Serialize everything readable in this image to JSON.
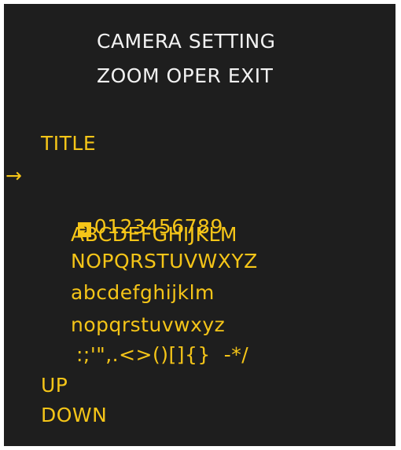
{
  "header": {
    "line1": "CAMERA SETTING",
    "line2": "ZOOM OPER EXIT"
  },
  "menu": {
    "title_label": "TITLE",
    "pointer_icon": "right-arrow-icon",
    "cursor_icon": "boxed-right-arrow-icon",
    "char_rows": [
      "0123456789",
      "ABCDEFGHIJKLM",
      "NOPQRSTUVWXYZ",
      "abcdefghijklm",
      "nopqrstuvwxyz",
      ":;'\",.<>()[]{}  -*/"
    ],
    "up_label": "UP",
    "down_label": "DOWN"
  },
  "colors": {
    "background": "#1e1e1e",
    "header_text": "#f2f2f2",
    "menu_text": "#f5c518"
  }
}
